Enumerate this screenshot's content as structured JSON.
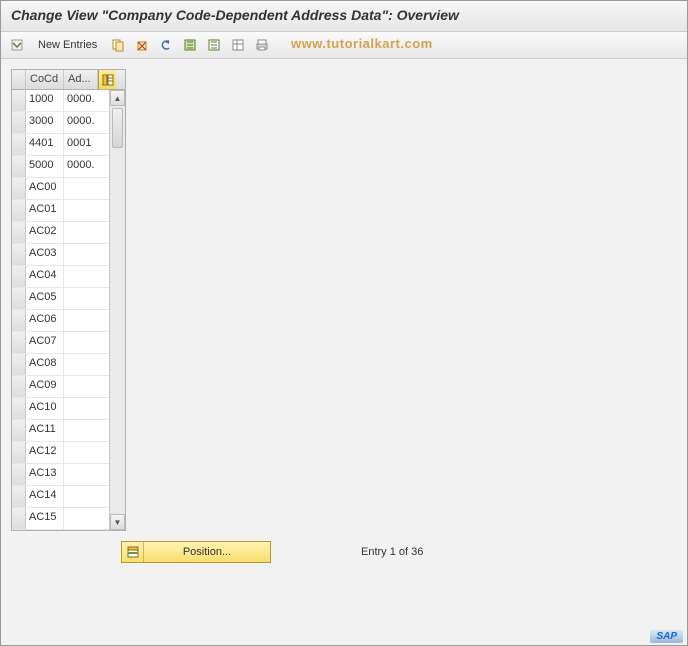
{
  "title": "Change View \"Company Code-Dependent Address Data\": Overview",
  "toolbar": {
    "new_entries": "New Entries"
  },
  "watermark": "www.tutorialkart.com",
  "table": {
    "headers": {
      "cocd": "CoCd",
      "ad": "Ad..."
    },
    "rows": [
      {
        "cocd": "1000",
        "ad": "0000."
      },
      {
        "cocd": "3000",
        "ad": "0000."
      },
      {
        "cocd": "4401",
        "ad": "0001"
      },
      {
        "cocd": "5000",
        "ad": "0000."
      },
      {
        "cocd": "AC00",
        "ad": ""
      },
      {
        "cocd": "AC01",
        "ad": ""
      },
      {
        "cocd": "AC02",
        "ad": ""
      },
      {
        "cocd": "AC03",
        "ad": ""
      },
      {
        "cocd": "AC04",
        "ad": ""
      },
      {
        "cocd": "AC05",
        "ad": ""
      },
      {
        "cocd": "AC06",
        "ad": ""
      },
      {
        "cocd": "AC07",
        "ad": ""
      },
      {
        "cocd": "AC08",
        "ad": ""
      },
      {
        "cocd": "AC09",
        "ad": ""
      },
      {
        "cocd": "AC10",
        "ad": ""
      },
      {
        "cocd": "AC11",
        "ad": ""
      },
      {
        "cocd": "AC12",
        "ad": ""
      },
      {
        "cocd": "AC13",
        "ad": ""
      },
      {
        "cocd": "AC14",
        "ad": ""
      },
      {
        "cocd": "AC15",
        "ad": ""
      }
    ]
  },
  "position_button": "Position...",
  "entry_status": "Entry 1 of 36",
  "logo": "SAP"
}
